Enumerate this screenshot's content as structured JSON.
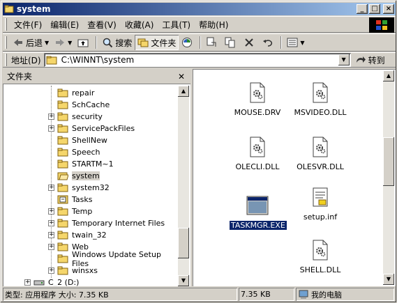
{
  "window": {
    "title": "system"
  },
  "menu": [
    "文件(F)",
    "编辑(E)",
    "查看(V)",
    "收藏(A)",
    "工具(T)",
    "帮助(H)"
  ],
  "toolbar": {
    "back": "后退",
    "search": "搜索",
    "folders": "文件夹"
  },
  "address": {
    "label": "地址(D)",
    "value": "C:\\WINNT\\system",
    "go": "转到"
  },
  "folder_pane": {
    "title": "文件夹",
    "items": [
      {
        "label": "repair",
        "expandable": false
      },
      {
        "label": "SchCache",
        "expandable": false
      },
      {
        "label": "security",
        "expandable": true
      },
      {
        "label": "ServicePackFiles",
        "expandable": true
      },
      {
        "label": "ShellNew",
        "expandable": false
      },
      {
        "label": "Speech",
        "expandable": false
      },
      {
        "label": "STARTM~1",
        "expandable": false
      },
      {
        "label": "system",
        "expandable": false,
        "selected": true
      },
      {
        "label": "system32",
        "expandable": true
      },
      {
        "label": "Tasks",
        "expandable": false
      },
      {
        "label": "Temp",
        "expandable": true
      },
      {
        "label": "Temporary Internet Files",
        "expandable": true
      },
      {
        "label": "twain_32",
        "expandable": true
      },
      {
        "label": "Web",
        "expandable": true
      },
      {
        "label": "Windows Update Setup Files",
        "expandable": false
      },
      {
        "label": "winsxs",
        "expandable": true
      }
    ],
    "drive": "C_2 (D:)"
  },
  "files": [
    {
      "name": "MOUSE.DRV",
      "type": "dll"
    },
    {
      "name": "MSVIDEO.DLL",
      "type": "dll"
    },
    {
      "name": "OLECLI.DLL",
      "type": "dll"
    },
    {
      "name": "OLESVR.DLL",
      "type": "dll"
    },
    {
      "name": "TASKMGR.EXE",
      "type": "exe",
      "selected": true
    },
    {
      "name": "setup.inf",
      "type": "inf"
    },
    {
      "name": "SHELL.DLL",
      "type": "dll"
    }
  ],
  "status": {
    "info": "类型: 应用程序 大小: 7.35 KB",
    "size": "7.35 KB",
    "zone": "我的电脑"
  },
  "colors": {
    "title_start": "#0a246a",
    "title_end": "#a6caf0",
    "selection": "#0a246a",
    "folder": "#f5d66b"
  }
}
